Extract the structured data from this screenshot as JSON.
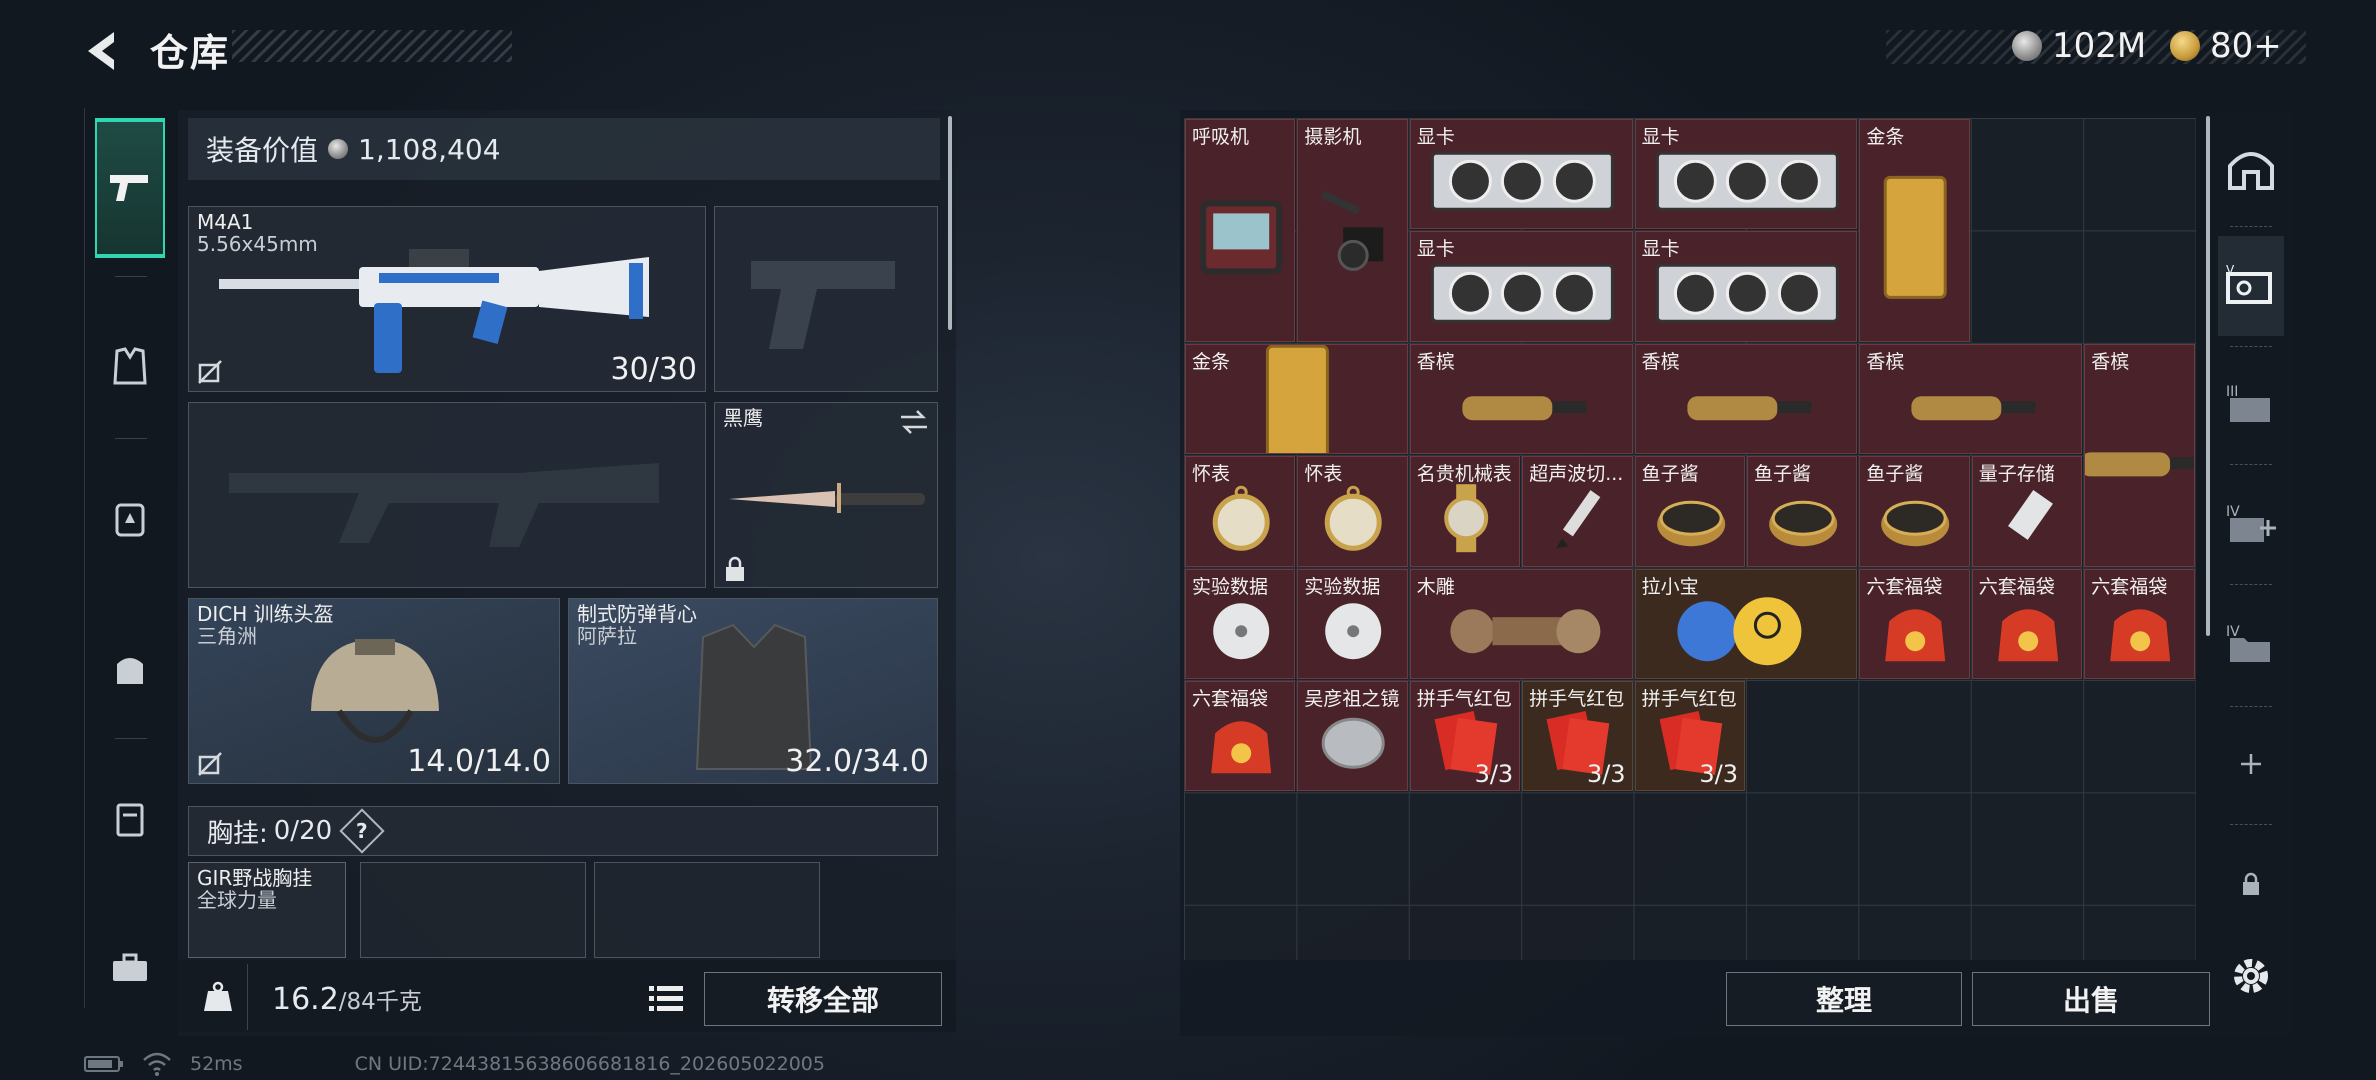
{
  "header": {
    "title": "仓库"
  },
  "currency": {
    "silver": "102M",
    "gold": "80+"
  },
  "left_tabs": [
    {
      "name": "weapons"
    },
    {
      "name": "armor"
    },
    {
      "name": "backpack-slot"
    },
    {
      "name": "bag"
    },
    {
      "name": "rig"
    },
    {
      "name": "briefcase"
    }
  ],
  "equipment": {
    "value_label": "装备价值",
    "value": "1,108,404",
    "primary": {
      "name": "M4A1",
      "caliber": "5.56x45mm",
      "ammo": "30/30"
    },
    "melee": {
      "name": "黑鹰"
    },
    "helmet": {
      "name": "DICH 训练头盔",
      "faction": "三角洲",
      "durability": "14.0/14.0"
    },
    "armor": {
      "name": "制式防弹背心",
      "faction": "阿萨拉",
      "durability": "32.0/34.0"
    },
    "chest": {
      "label": "胸挂:",
      "count": "0/20",
      "help": "?"
    },
    "rig": {
      "name": "GIR野战胸挂",
      "faction": "全球力量"
    },
    "weight": {
      "current": "16.2",
      "capacity": "/84千克"
    },
    "transfer_all": "转移全部"
  },
  "storage": {
    "items": [
      {
        "label": "呼吸机",
        "icon": "ventilator"
      },
      {
        "label": "摄影机",
        "icon": "camera"
      },
      {
        "label": "显卡",
        "icon": "gpu"
      },
      {
        "label": "显卡",
        "icon": "gpu"
      },
      {
        "label": "显卡",
        "icon": "gpu"
      },
      {
        "label": "显卡",
        "icon": "gpu"
      },
      {
        "label": "金条",
        "icon": "gold-bar"
      },
      {
        "label": "金条",
        "icon": "gold-bar"
      },
      {
        "label": "香槟",
        "icon": "champagne"
      },
      {
        "label": "香槟",
        "icon": "champagne"
      },
      {
        "label": "香槟",
        "icon": "champagne"
      },
      {
        "label": "香槟",
        "icon": "champagne"
      },
      {
        "label": "怀表",
        "icon": "pocket-watch"
      },
      {
        "label": "怀表",
        "icon": "pocket-watch"
      },
      {
        "label": "名贵机械表",
        "icon": "wristwatch"
      },
      {
        "label": "超声波切...",
        "icon": "ultrasonic-cutter"
      },
      {
        "label": "鱼子酱",
        "icon": "caviar"
      },
      {
        "label": "鱼子酱",
        "icon": "caviar"
      },
      {
        "label": "鱼子酱",
        "icon": "caviar"
      },
      {
        "label": "量子存储",
        "icon": "quantum-storage"
      },
      {
        "label": "实验数据",
        "icon": "data-disc"
      },
      {
        "label": "实验数据",
        "icon": "data-disc"
      },
      {
        "label": "木雕",
        "icon": "wood-carving"
      },
      {
        "label": "拉小宝",
        "icon": "plush-toy"
      },
      {
        "label": "六套福袋",
        "icon": "lucky-bag"
      },
      {
        "label": "六套福袋",
        "icon": "lucky-bag"
      },
      {
        "label": "六套福袋",
        "icon": "lucky-bag"
      },
      {
        "label": "六套福袋",
        "icon": "lucky-bag"
      },
      {
        "label": "吴彦祖之镜",
        "icon": "mirror"
      },
      {
        "label": "拼手气红包",
        "count": "3/3",
        "icon": "red-envelope"
      },
      {
        "label": "拼手气红包",
        "count": "3/3",
        "icon": "red-envelope"
      },
      {
        "label": "拼手气红包",
        "count": "3/3",
        "icon": "red-envelope"
      }
    ],
    "sort_button": "整理",
    "sell_button": "出售"
  },
  "right_tabs": [
    "shelter",
    "storage-box",
    "III",
    "IV-add",
    "IV-folder",
    "+",
    "lock",
    "settings"
  ],
  "status": {
    "ping": "52ms",
    "uid": "CN UID:72443815638606681816_202605022005"
  },
  "colors": {
    "accent": "#2fd6b1",
    "item_bg": "#4a2229",
    "item_bg_dark": "#3c2a1e"
  }
}
